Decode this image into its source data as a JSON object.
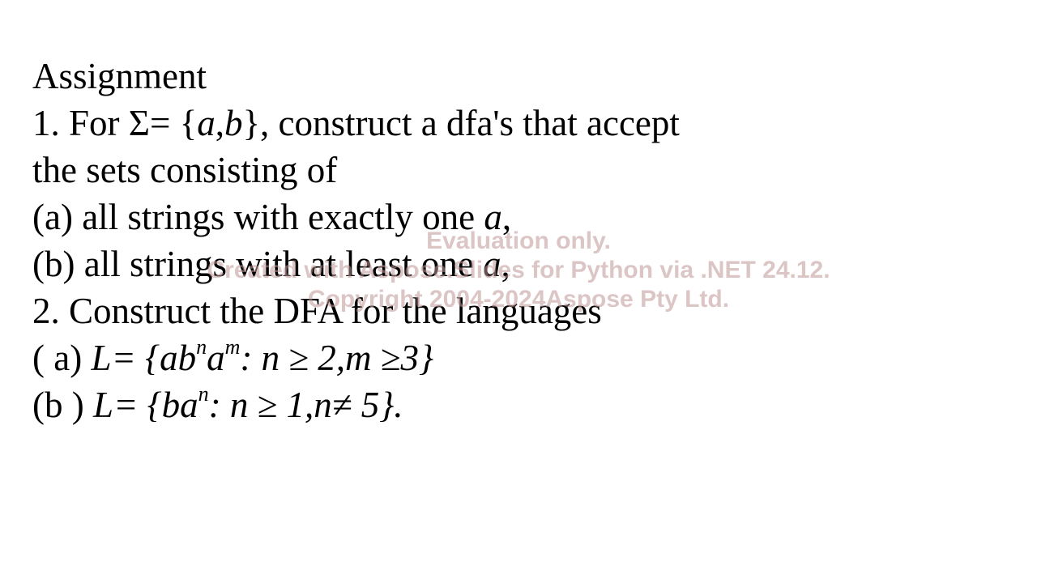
{
  "slide": {
    "title": "Assignment",
    "q1": {
      "prefix": "1. For Σ= {",
      "var_a": "a",
      "comma": ",",
      "var_b": "b",
      "suffix": "}, construct a dfa's that accept",
      "cont": "the sets consisting of"
    },
    "q1a": {
      "prefix": "(a) all strings with exactly one ",
      "var": "a",
      "suffix": ","
    },
    "q1b": {
      "prefix": "(b) all strings with at least one ",
      "var": "a",
      "suffix": ","
    },
    "q2": {
      "text": "2. Construct the DFA for the languages"
    },
    "q2a": {
      "label": "( a) ",
      "expr_start": "L= {ab",
      "sup_n": "n",
      "mid": "a",
      "sup_m": "m",
      "expr_end": ": n ≥ 2,m ≥3}"
    },
    "q2b": {
      "label": "(b ) ",
      "expr_start": "L= {ba",
      "sup_n": "n",
      "expr_end": ": n ≥ 1,n≠ 5}",
      "period": "."
    }
  },
  "watermark": {
    "line1": "Evaluation only.",
    "line2": "Created with Aspose.Slides for Python via .NET 24.12.",
    "line3": "Copyright 2004-2024Aspose Pty Ltd."
  }
}
